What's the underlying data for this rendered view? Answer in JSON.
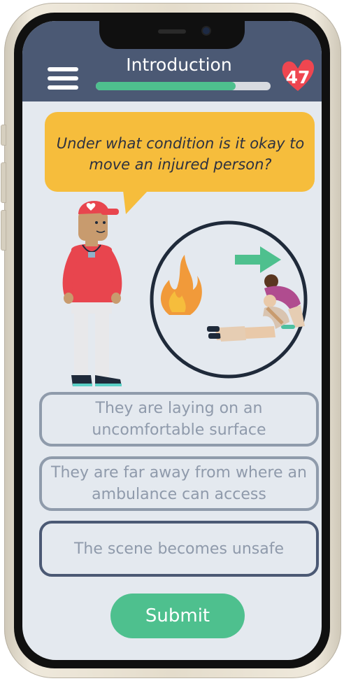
{
  "header": {
    "title": "Introduction",
    "progress_fraction": 0.8,
    "hearts_count": "47",
    "accent_color": "#4ec08e",
    "bar_color": "#4b5974"
  },
  "question": {
    "text": "Under what condition is it okay to move an injured person?"
  },
  "answers": [
    {
      "label": "They are laying on an uncomfortable surface",
      "selected": false
    },
    {
      "label": "They are far away from where an ambulance can access",
      "selected": false
    },
    {
      "label": "The scene becomes unsafe",
      "selected": true
    }
  ],
  "submit": {
    "label": "Submit"
  },
  "icons": {
    "menu": "hamburger-icon",
    "hearts": "heart-icon",
    "arrow": "arrow-right-icon",
    "fire": "fire-icon"
  }
}
